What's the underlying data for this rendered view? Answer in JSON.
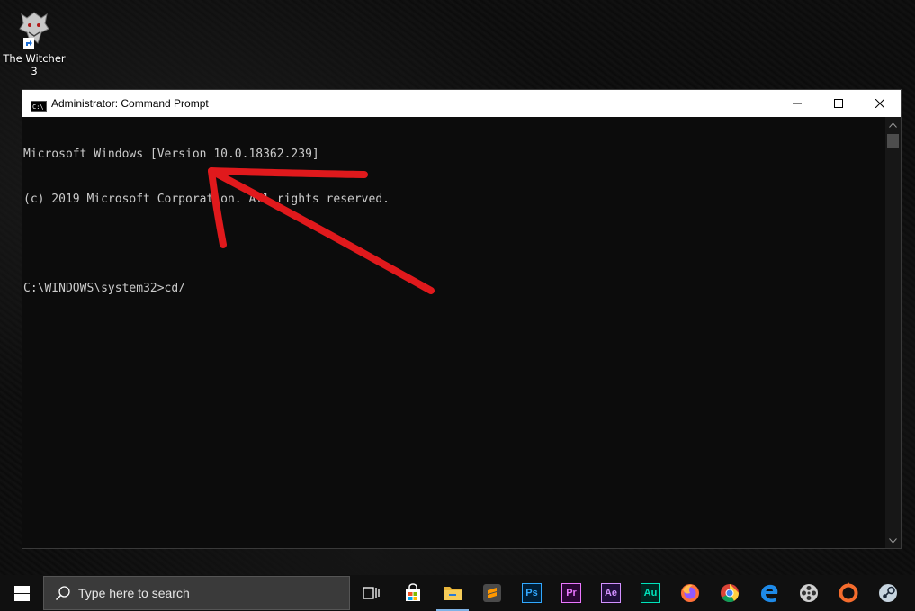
{
  "desktop": {
    "icon_label": "The Witcher 3"
  },
  "window": {
    "title": "Administrator: Command Prompt",
    "console_lines": [
      "Microsoft Windows [Version 10.0.18362.239]",
      "(c) 2019 Microsoft Corporation. All rights reserved.",
      "",
      "C:\\WINDOWS\\system32>cd/"
    ]
  },
  "taskbar": {
    "search_placeholder": "Type here to search",
    "apps": [
      {
        "name": "task-view",
        "icon": "task-view-icon"
      },
      {
        "name": "store",
        "icon": "store-icon"
      },
      {
        "name": "file-explorer",
        "icon": "folder-icon",
        "active": true
      },
      {
        "name": "sublime-text",
        "icon": "sublime-icon"
      },
      {
        "name": "photoshop",
        "label": "Ps"
      },
      {
        "name": "premiere",
        "label": "Pr"
      },
      {
        "name": "after-effects",
        "label": "Ae"
      },
      {
        "name": "audition",
        "label": "Au"
      },
      {
        "name": "firefox",
        "icon": "firefox-icon"
      },
      {
        "name": "chrome",
        "icon": "chrome-icon"
      },
      {
        "name": "edge",
        "icon": "edge-icon"
      },
      {
        "name": "media-player",
        "icon": "film-reel-icon"
      },
      {
        "name": "origin",
        "icon": "origin-icon"
      },
      {
        "name": "steam",
        "icon": "steam-icon"
      }
    ]
  },
  "colors": {
    "console_bg": "#0c0c0c",
    "console_text": "#cccccc",
    "annotation_arrow": "#e0191c",
    "photoshop": "#31a8ff",
    "premiere": "#ea77ff",
    "after_effects": "#d291ff",
    "audition": "#00e4bb"
  }
}
